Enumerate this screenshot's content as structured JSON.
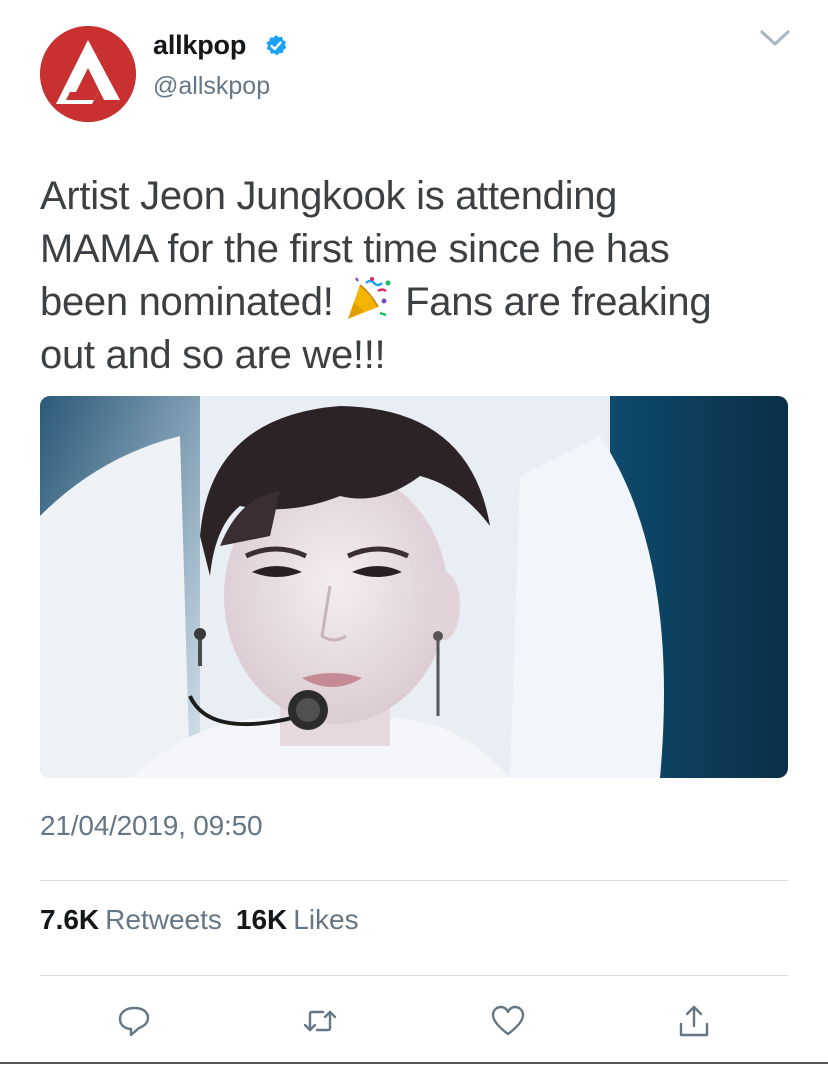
{
  "header": {
    "display_name": "allkpop",
    "handle": "@allskpop",
    "verified": true
  },
  "tweet": {
    "text_lines": [
      "Artist Jeon Jungkook is attending",
      "MAMA for the first time since he has",
      "been nominated! ",
      " Fans are freaking",
      "out and so are we!!!"
    ],
    "emoji": "party-popper",
    "timestamp": "21/04/2019, 09:50"
  },
  "stats": {
    "retweets_count": "7.6K",
    "retweets_label": "Retweets",
    "likes_count": "16K",
    "likes_label": "Likes"
  },
  "actions": [
    {
      "icon": "reply-icon"
    },
    {
      "icon": "retweet-icon"
    },
    {
      "icon": "like-icon"
    },
    {
      "icon": "share-icon"
    }
  ],
  "colors": {
    "brand_red": "#c8312f",
    "verified_blue": "#1da1f2",
    "secondary_text": "#657786",
    "primary_text": "#14171a"
  }
}
